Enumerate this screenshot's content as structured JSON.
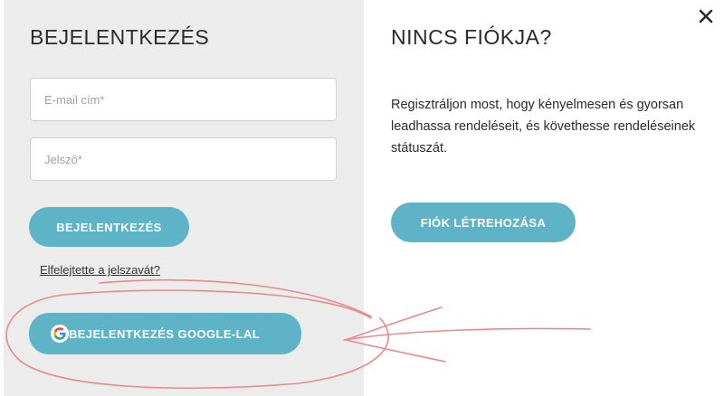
{
  "login": {
    "title": "BEJELENTKEZÉS",
    "email_placeholder": "E-mail cím*",
    "password_placeholder": "Jelszó*",
    "submit_label": "BEJELENTKEZÉS",
    "forgot_label": "Elfelejtette a jelszavát?",
    "google_label": "BEJELENTKEZÉS GOOGLE-LAL"
  },
  "register": {
    "title": "NINCS FIÓKJA?",
    "description": "Regisztráljon most, hogy kényelmesen és gyorsan leadhassa rendeléseit, és követhesse rendeléseinek státuszát.",
    "create_label": "FIÓK LÉTREHOZÁSA"
  },
  "icons": {
    "close": "close-icon",
    "google": "google-icon"
  },
  "colors": {
    "accent": "#5fb3c7",
    "left_bg": "#ececec",
    "annotation": "#e88a8a"
  }
}
